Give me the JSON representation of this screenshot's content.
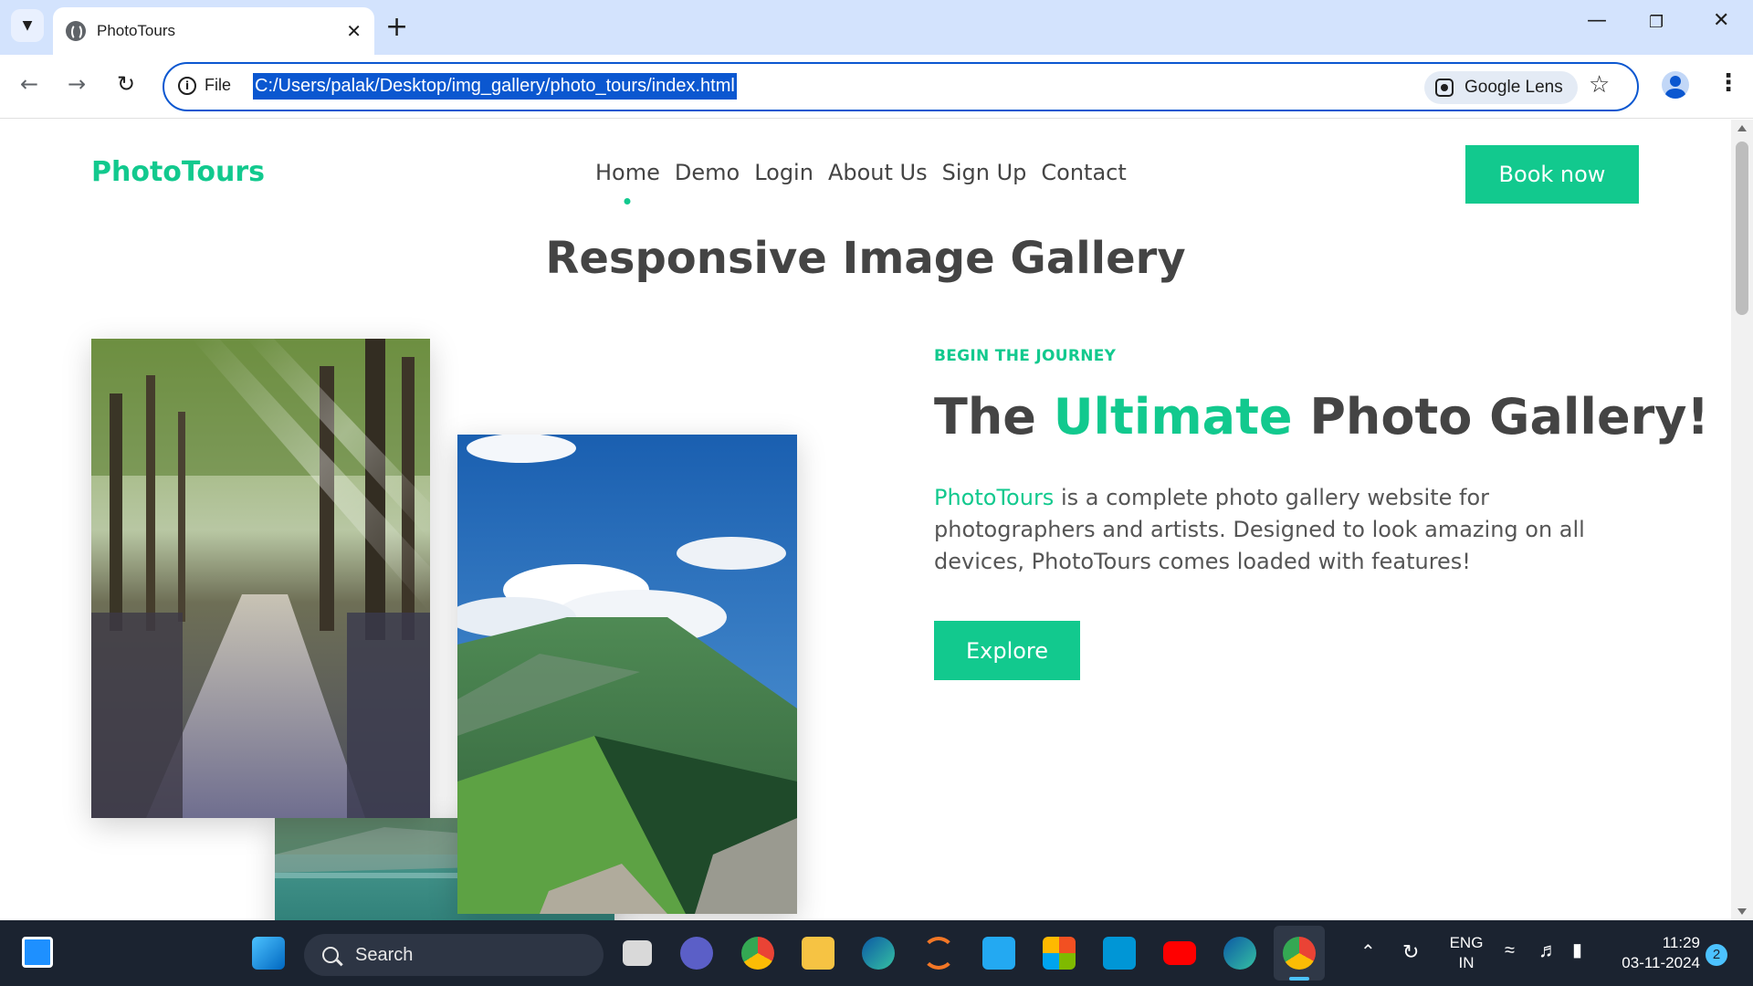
{
  "browser": {
    "tab_title": "PhotoTours",
    "new_tab_label": "+",
    "omnibox": {
      "scheme_label": "File",
      "url": "C:/Users/palak/Desktop/img_gallery/photo_tours/index.html",
      "lens_label": "Google Lens"
    }
  },
  "site": {
    "logo": "PhotoTours",
    "nav": [
      "Home",
      "Demo",
      "Login",
      "About Us",
      "Sign Up",
      "Contact"
    ],
    "active_nav": "Home",
    "book_button": "Book now",
    "gallery_title": "Responsive Image Gallery",
    "hero": {
      "eyebrow": "BEGIN THE JOURNEY",
      "title_before": "The ",
      "title_accent": "Ultimate",
      "title_after": " Photo Gallery!",
      "text_brand": "PhotoTours",
      "text_rest": " is a complete photo gallery website for photographers and artists. Designed to look amazing on all devices, PhotoTours comes loaded with features!",
      "explore_button": "Explore"
    },
    "accent_color": "#12c98e"
  },
  "taskbar": {
    "search_label": "Search",
    "lang_line1": "ENG",
    "lang_line2": "IN",
    "time": "11:29",
    "date": "03-11-2024",
    "notification_count": "2"
  }
}
